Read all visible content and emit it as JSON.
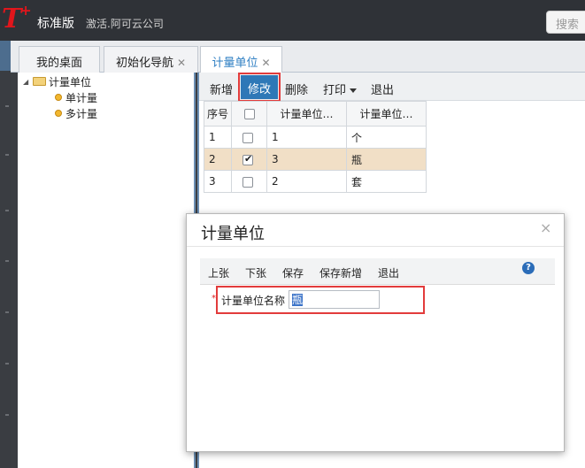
{
  "app": {
    "logo": "T",
    "logo_plus": "+",
    "edition": "标准版",
    "company": "激活.阿可云公司",
    "search_placeholder": "搜索"
  },
  "tabs": [
    {
      "label": "我的桌面",
      "closable": false
    },
    {
      "label": "初始化导航",
      "closable": true
    },
    {
      "label": "计量单位",
      "closable": true,
      "active": true
    }
  ],
  "close_glyph": "✕",
  "tree": {
    "root": "计量单位",
    "children": [
      "单计量",
      "多计量"
    ]
  },
  "toolbar": {
    "add": "新增",
    "edit": "修改",
    "delete": "删除",
    "print": "打印",
    "exit": "退出"
  },
  "grid": {
    "headers": [
      "序号",
      "",
      "计量单位…",
      "计量单位…"
    ],
    "rows": [
      {
        "index": "1",
        "checked": false,
        "code": "1",
        "name": "个"
      },
      {
        "index": "2",
        "checked": true,
        "code": "3",
        "name": "瓶",
        "selected": true
      },
      {
        "index": "3",
        "checked": false,
        "code": "2",
        "name": "套"
      }
    ]
  },
  "dialog": {
    "title": "计量单位",
    "close": "×",
    "toolbar": {
      "prev": "上张",
      "next": "下张",
      "save": "保存",
      "save_new": "保存新增",
      "exit": "退出",
      "help": "?"
    },
    "field_required": "*",
    "field_label": "计量单位名称",
    "field_value": "瓶"
  },
  "colors": {
    "accent_blue": "#2e78b7",
    "highlight_red": "#e23b3b",
    "selected_row": "#f1dfc6",
    "brand_red": "#e0161c"
  }
}
